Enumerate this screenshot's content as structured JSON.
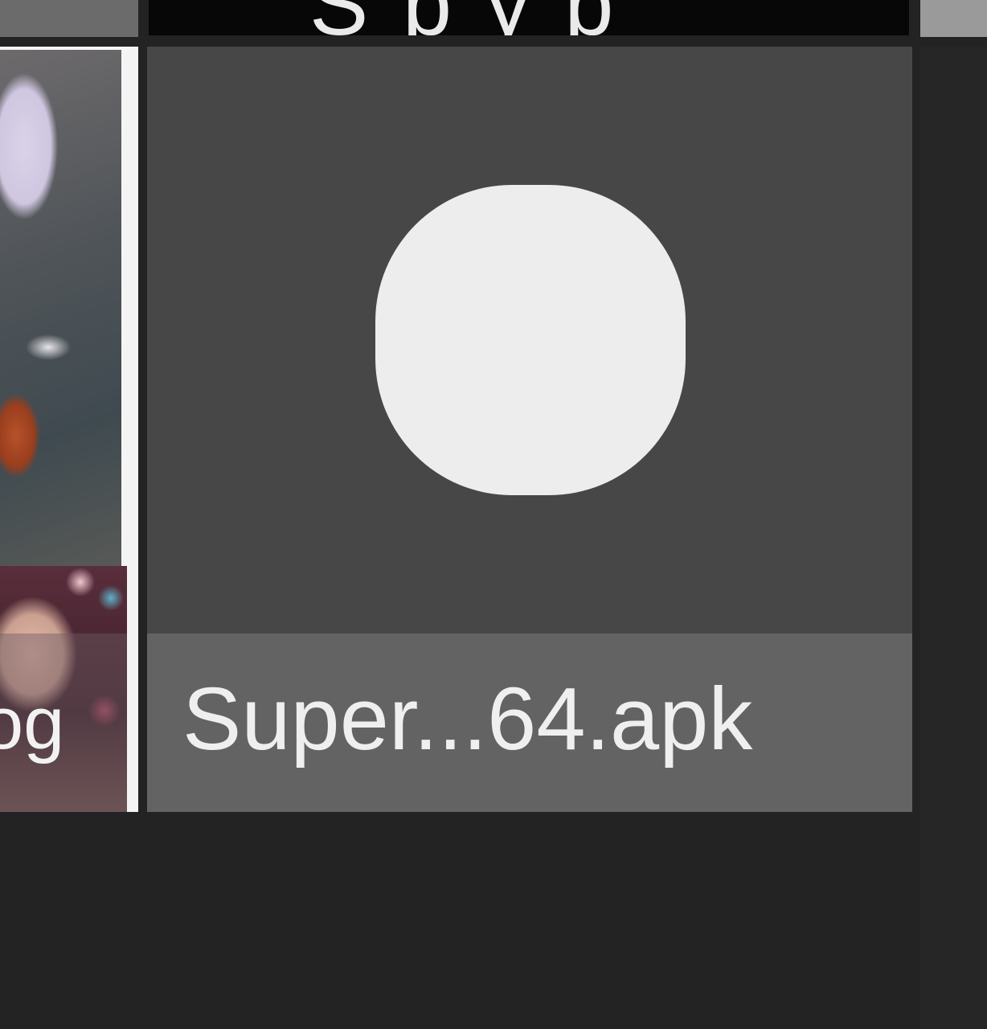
{
  "grid": {
    "top_row": {
      "middle_cut_text": "S p y p"
    },
    "left_tile": {
      "label": "og"
    },
    "file_tile": {
      "icon": "rounded-square-app-icon",
      "label": "Super...64.apk"
    }
  },
  "colors": {
    "background": "#232323",
    "tile_background": "#474747",
    "label_bar": "#636363",
    "icon_fill": "#ededed",
    "label_text": "#efefef"
  }
}
